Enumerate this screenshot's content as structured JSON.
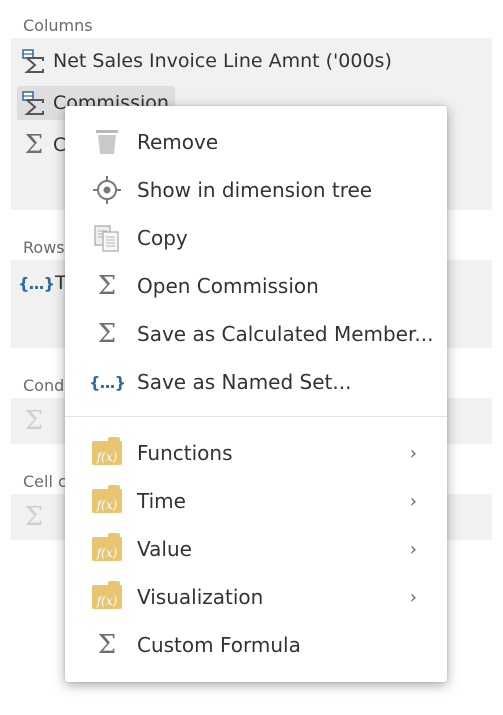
{
  "columns": {
    "label": "Columns",
    "items": [
      {
        "label": "Net Sales Invoice Line Amnt ('000s)",
        "icon": "calc-measure-icon"
      },
      {
        "label": "Commission",
        "icon": "calc-measure-icon",
        "selected": true
      },
      {
        "label": "C",
        "icon": "sigma-icon"
      }
    ]
  },
  "rows": {
    "label": "Rows",
    "items": [
      {
        "label": "T",
        "icon": "named-set-icon"
      }
    ]
  },
  "conditions": {
    "label": "Cond"
  },
  "cell": {
    "label": "Cell c"
  },
  "menu": {
    "items": [
      {
        "label": "Remove",
        "icon": "trash-icon"
      },
      {
        "label": "Show in dimension tree",
        "icon": "target-icon"
      },
      {
        "label": "Copy",
        "icon": "copy-icon"
      },
      {
        "label": "Open Commission",
        "icon": "sigma-icon"
      },
      {
        "label": "Save as Calculated Member...",
        "icon": "sigma-icon"
      },
      {
        "label": "Save as Named Set...",
        "icon": "named-set-icon"
      }
    ],
    "submenus": [
      {
        "label": "Functions",
        "icon": "fx-folder-icon",
        "chevron": "›"
      },
      {
        "label": "Time",
        "icon": "fx-folder-icon",
        "chevron": "›"
      },
      {
        "label": "Value",
        "icon": "fx-folder-icon",
        "chevron": "›"
      },
      {
        "label": "Visualization",
        "icon": "fx-folder-icon",
        "chevron": "›"
      }
    ],
    "custom": {
      "label": "Custom Formula",
      "icon": "sigma-icon"
    }
  },
  "glyphs": {
    "sigma": "Σ",
    "braces": "{...}",
    "fx": "f(x)"
  },
  "colors": {
    "panel": "#f1f1f1",
    "selected": "#dedede",
    "fx_folder": "#e8c56e",
    "named_set": "#2b6aa5"
  }
}
